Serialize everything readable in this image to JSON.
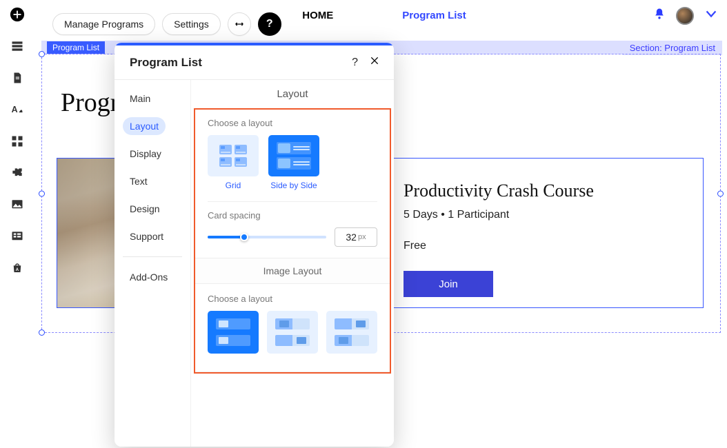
{
  "topnav": {
    "home": "HOME",
    "program_list": "Program List"
  },
  "toolbar": {
    "manage_programs": "Manage Programs",
    "settings": "Settings"
  },
  "section": {
    "chip": "Program List",
    "label": "Section: Program List"
  },
  "canvas": {
    "heading": "Progra"
  },
  "card": {
    "title": "Productivity Crash Course",
    "meta": "5 Days • 1 Participant",
    "price": "Free",
    "join": "Join"
  },
  "panel": {
    "title": "Program List",
    "tabs": {
      "main": "Main",
      "layout": "Layout",
      "display": "Display",
      "text": "Text",
      "design": "Design",
      "support": "Support",
      "addons": "Add-Ons"
    },
    "layout_section": {
      "header": "Layout",
      "choose_label": "Choose a layout",
      "grid": "Grid",
      "side_by_side": "Side by Side",
      "spacing_label": "Card spacing",
      "spacing_value": "32",
      "spacing_unit": "px",
      "image_layout_header": "Image Layout",
      "img_choose_label": "Choose a layout"
    }
  }
}
